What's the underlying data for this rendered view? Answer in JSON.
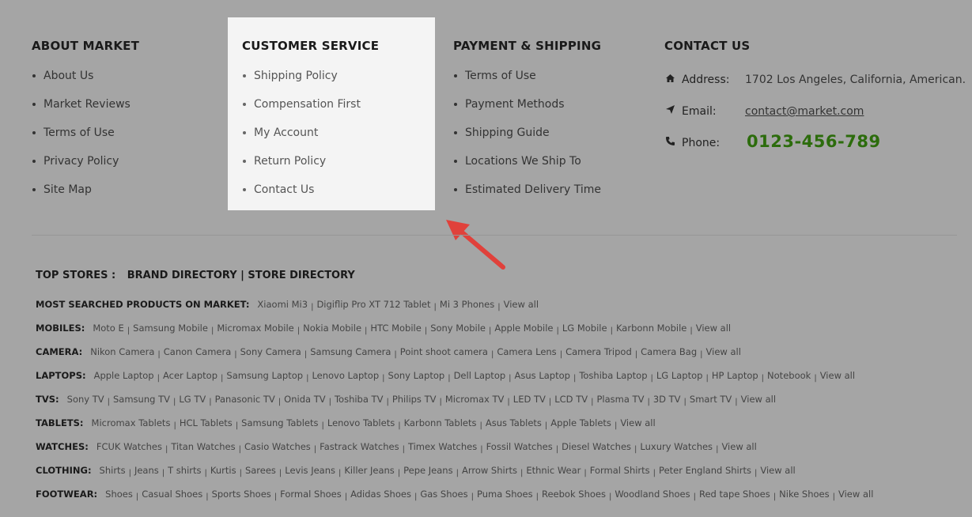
{
  "about": {
    "title": "ABOUT MARKET",
    "items": [
      "About Us",
      "Market Reviews",
      "Terms of Use",
      "Privacy Policy",
      "Site Map"
    ]
  },
  "customer_service": {
    "title": "CUSTOMER SERVICE",
    "items": [
      "Shipping Policy",
      "Compensation First",
      "My Account",
      "Return Policy",
      "Contact Us"
    ]
  },
  "payment": {
    "title": "PAYMENT & SHIPPING",
    "items": [
      "Terms of Use",
      "Payment Methods",
      "Shipping Guide",
      "Locations We Ship To",
      "Estimated Delivery Time"
    ]
  },
  "contact": {
    "title": "CONTACT US",
    "address_label": "Address:",
    "address_value": "1702 Los Angeles, California, American.",
    "email_label": "Email:",
    "email_value": "contact@market.com",
    "phone_label": "Phone:",
    "phone_value": "0123-456-789",
    "icons": [
      "home-icon",
      "paper-plane-icon",
      "phone-icon"
    ]
  },
  "top_stores": {
    "label": "TOP STORES :",
    "links": "BRAND DIRECTORY | STORE DIRECTORY"
  },
  "categories": [
    {
      "label": "MOST SEARCHED PRODUCTS ON MARKET:",
      "items": [
        "Xiaomi Mi3",
        "Digiflip Pro XT 712 Tablet",
        "Mi 3 Phones",
        "View all"
      ]
    },
    {
      "label": "MOBILES:",
      "items": [
        "Moto E",
        "Samsung Mobile",
        "Micromax Mobile",
        "Nokia Mobile",
        "HTC Mobile",
        "Sony Mobile",
        "Apple Mobile",
        "LG Mobile",
        "Karbonn Mobile",
        "View all"
      ]
    },
    {
      "label": "CAMERA:",
      "items": [
        "Nikon Camera",
        "Canon Camera",
        "Sony Camera",
        "Samsung Camera",
        "Point shoot camera",
        "Camera Lens",
        "Camera Tripod",
        "Camera Bag",
        "View all"
      ]
    },
    {
      "label": "LAPTOPS:",
      "items": [
        "Apple Laptop",
        "Acer Laptop",
        "Samsung Laptop",
        "Lenovo Laptop",
        "Sony Laptop",
        "Dell Laptop",
        "Asus Laptop",
        "Toshiba Laptop",
        "LG Laptop",
        "HP Laptop",
        "Notebook",
        "View all"
      ]
    },
    {
      "label": "TVS:",
      "items": [
        "Sony TV",
        "Samsung TV",
        "LG TV",
        "Panasonic TV",
        "Onida TV",
        "Toshiba TV",
        "Philips TV",
        "Micromax TV",
        "LED TV",
        "LCD TV",
        "Plasma TV",
        "3D TV",
        "Smart TV",
        "View all"
      ]
    },
    {
      "label": "TABLETS:",
      "items": [
        "Micromax Tablets",
        "HCL Tablets",
        "Samsung Tablets",
        "Lenovo Tablets",
        "Karbonn Tablets",
        "Asus Tablets",
        "Apple Tablets",
        "View all"
      ]
    },
    {
      "label": "WATCHES:",
      "items": [
        "FCUK Watches",
        "Titan Watches",
        "Casio Watches",
        "Fastrack Watches",
        "Timex Watches",
        "Fossil Watches",
        "Diesel Watches",
        "Luxury Watches",
        "View all"
      ]
    },
    {
      "label": "CLOTHING:",
      "items": [
        "Shirts",
        "Jeans",
        "T shirts",
        "Kurtis",
        "Sarees",
        "Levis Jeans",
        "Killer Jeans",
        "Pepe Jeans",
        "Arrow Shirts",
        "Ethnic Wear",
        "Formal Shirts",
        "Peter England Shirts",
        "View all"
      ]
    },
    {
      "label": "FOOTWEAR:",
      "items": [
        "Shoes",
        "Casual Shoes",
        "Sports Shoes",
        "Formal Shoes",
        "Adidas Shoes",
        "Gas Shoes",
        "Puma Shoes",
        "Reebok Shoes",
        "Woodland Shoes",
        "Red tape Shoes",
        "Nike Shoes",
        "View all"
      ]
    }
  ],
  "colors": {
    "overlay_bg": "#a5a5a5",
    "highlight_panel": "#f4f4f4",
    "phone_green": "#2c6c0c",
    "arrow_red": "#e0413b"
  }
}
